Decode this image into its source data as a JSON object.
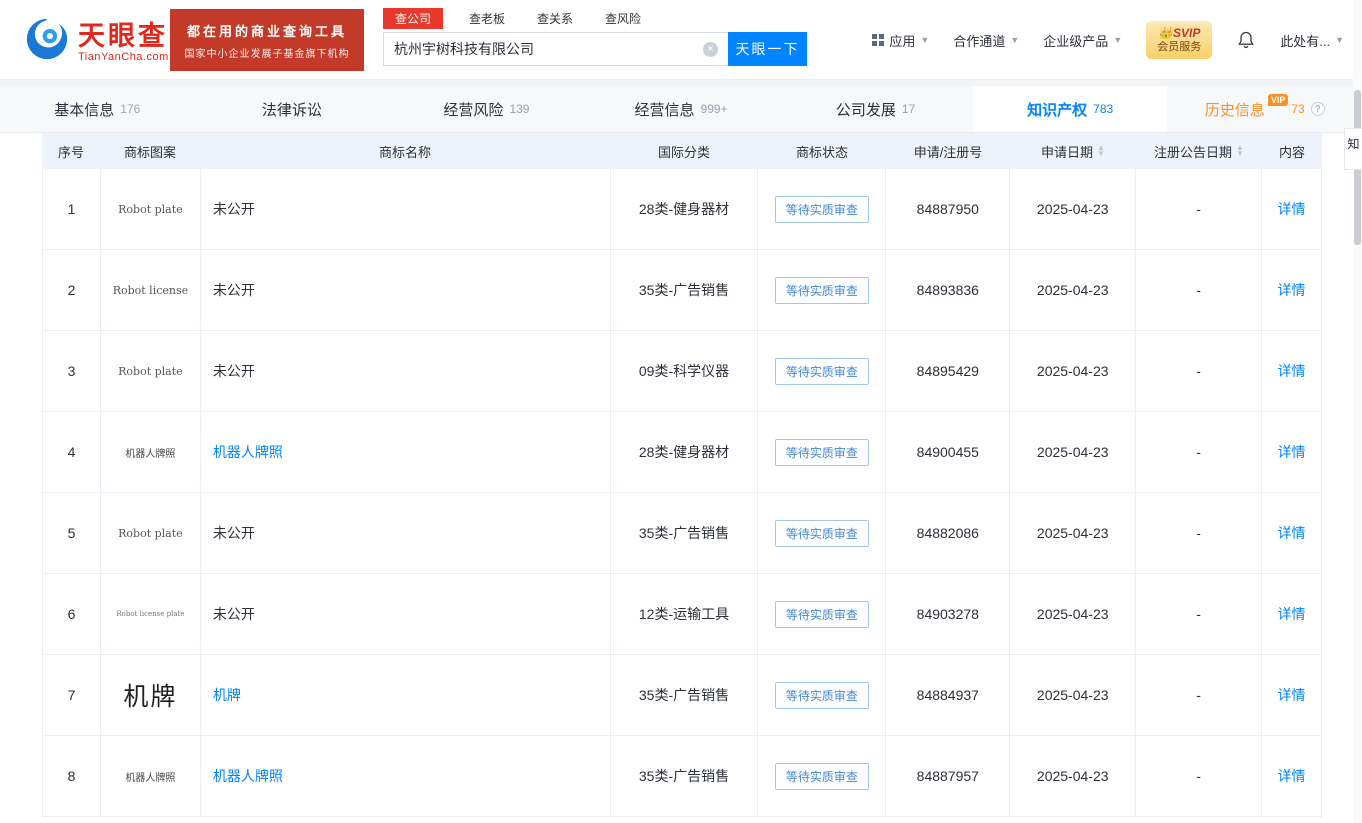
{
  "header": {
    "logo": {
      "brand": "天眼查",
      "domain": "TianYanCha.com"
    },
    "promo": {
      "line1": "都在用的商业查询工具",
      "line2": "国家中小企业发展子基金旗下机构"
    },
    "search": {
      "tabs": [
        {
          "label": "查公司",
          "active": true
        },
        {
          "label": "查老板",
          "active": false
        },
        {
          "label": "查关系",
          "active": false
        },
        {
          "label": "查风险",
          "active": false
        }
      ],
      "value": "杭州宇树科技有限公司",
      "button": "天眼一下"
    },
    "nav": [
      {
        "label": "应用"
      },
      {
        "label": "合作通道"
      },
      {
        "label": "企业级产品"
      }
    ],
    "vip": {
      "line1": "SVIP",
      "line2": "会员服务"
    },
    "more": "此处有..."
  },
  "page_tabs": [
    {
      "label": "基本信息",
      "count": "176"
    },
    {
      "label": "法律诉讼",
      "count": ""
    },
    {
      "label": "经营风险",
      "count": "139"
    },
    {
      "label": "经营信息",
      "count": "999+"
    },
    {
      "label": "公司发展",
      "count": "17"
    },
    {
      "label": "知识产权",
      "count": "783",
      "active": true
    },
    {
      "label": "历史信息",
      "count": "73",
      "vip_label": "VIP",
      "help": "?"
    }
  ],
  "table": {
    "headers": [
      {
        "label": "序号"
      },
      {
        "label": "商标图案"
      },
      {
        "label": "商标名称"
      },
      {
        "label": "国际分类"
      },
      {
        "label": "商标状态"
      },
      {
        "label": "申请/注册号"
      },
      {
        "label": "申请日期",
        "sortable": true
      },
      {
        "label": "注册公告日期",
        "sortable": true
      },
      {
        "label": "内容"
      }
    ],
    "rows": [
      {
        "no": "1",
        "image": "Robot plate",
        "image_size": "normal",
        "name": "未公开",
        "name_link": false,
        "category": "28类-健身器材",
        "status": "等待实质审查",
        "reg_no": "84887950",
        "apply_date": "2025-04-23",
        "announce_date": "-",
        "action": "详情"
      },
      {
        "no": "2",
        "image": "Robot license",
        "image_size": "normal",
        "name": "未公开",
        "name_link": false,
        "category": "35类-广告销售",
        "status": "等待实质审查",
        "reg_no": "84893836",
        "apply_date": "2025-04-23",
        "announce_date": "-",
        "action": "详情"
      },
      {
        "no": "3",
        "image": "Robot plate",
        "image_size": "normal",
        "name": "未公开",
        "name_link": false,
        "category": "09类-科学仪器",
        "status": "等待实质审查",
        "reg_no": "84895429",
        "apply_date": "2025-04-23",
        "announce_date": "-",
        "action": "详情"
      },
      {
        "no": "4",
        "image": "机器人牌照",
        "image_size": "small",
        "name": "机器人牌照",
        "name_link": true,
        "category": "28类-健身器材",
        "status": "等待实质审查",
        "reg_no": "84900455",
        "apply_date": "2025-04-23",
        "announce_date": "-",
        "action": "详情"
      },
      {
        "no": "5",
        "image": "Robot plate",
        "image_size": "normal",
        "name": "未公开",
        "name_link": false,
        "category": "35类-广告销售",
        "status": "等待实质审查",
        "reg_no": "84882086",
        "apply_date": "2025-04-23",
        "announce_date": "-",
        "action": "详情"
      },
      {
        "no": "6",
        "image": "Robot license plate",
        "image_size": "tiny",
        "name": "未公开",
        "name_link": false,
        "category": "12类-运输工具",
        "status": "等待实质审查",
        "reg_no": "84903278",
        "apply_date": "2025-04-23",
        "announce_date": "-",
        "action": "详情"
      },
      {
        "no": "7",
        "image": "机牌",
        "image_size": "large",
        "name": "机牌",
        "name_link": true,
        "category": "35类-广告销售",
        "status": "等待实质审查",
        "reg_no": "84884937",
        "apply_date": "2025-04-23",
        "announce_date": "-",
        "action": "详情"
      },
      {
        "no": "8",
        "image": "机器人牌照",
        "image_size": "small",
        "name": "机器人牌照",
        "name_link": true,
        "category": "35类-广告销售",
        "status": "等待实质审查",
        "reg_no": "84887957",
        "apply_date": "2025-04-23",
        "announce_date": "-",
        "action": "详情"
      }
    ]
  },
  "side": {
    "anchor": "知"
  },
  "colors": {
    "brand_red": "#e0281e",
    "accent_blue": "#0084ff",
    "history_orange": "#ff8f1f",
    "promo_red": "#c43a28"
  }
}
